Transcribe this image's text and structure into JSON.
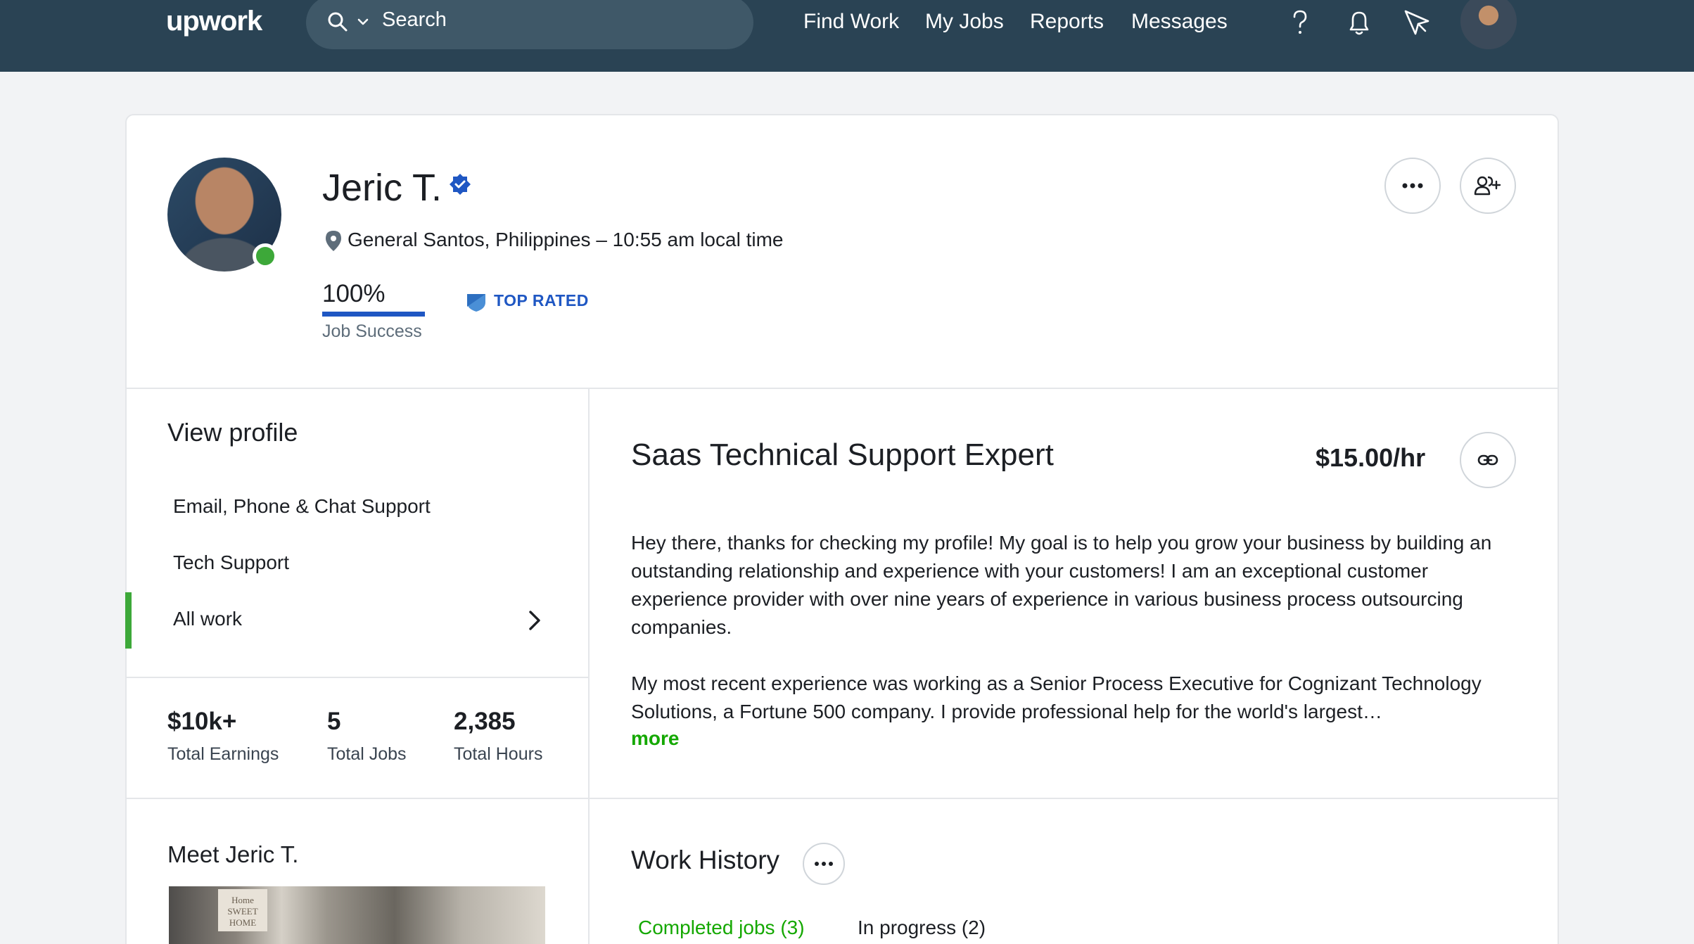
{
  "nav": {
    "logo": "upwork",
    "search_label": "Search",
    "links": [
      "Find Work",
      "My Jobs",
      "Reports",
      "Messages"
    ],
    "icons": [
      "search-icon",
      "chevron-down-icon",
      "help-icon",
      "bell-icon",
      "direct-contracts-icon"
    ],
    "colors": {
      "bar": "#2a4354",
      "search": "#3f5868"
    }
  },
  "profile": {
    "name": "Jeric T.",
    "location": "General Santos, Philippines – 10:55 am local time",
    "job_success": {
      "value": "100%",
      "label": "Job Success",
      "fraction": 1.0
    },
    "badge": "TOP RATED",
    "online": true,
    "colors": {
      "accent_blue": "#1f57c3",
      "online_green": "#3da839"
    }
  },
  "sidebar": {
    "title": "View profile",
    "items": [
      {
        "label": "Email, Phone & Chat Support",
        "active": false
      },
      {
        "label": "Tech Support",
        "active": false
      },
      {
        "label": "All work",
        "active": true
      }
    ]
  },
  "stats": [
    {
      "value": "$10k+",
      "label": "Total Earnings"
    },
    {
      "value": "5",
      "label": "Total Jobs"
    },
    {
      "value": "2,385",
      "label": "Total Hours"
    }
  ],
  "video": {
    "title": "Meet Jeric T.",
    "sign_text": [
      "Home",
      "SWEET",
      "HOME"
    ]
  },
  "job": {
    "title": "Saas Technical Support Expert",
    "rate": "$15.00/hr",
    "overview": [
      "Hey there, thanks for checking my profile! My goal is to help you grow your business by building an outstanding relationship and experience with your customers! I am an exceptional customer experience provider with over nine years of experience in various business process outsourcing companies.",
      "My most recent experience was working as a Senior Process Executive for Cognizant Technology Solutions, a Fortune 500 company. I provide professional help for the world's largest…"
    ],
    "more_label": "more"
  },
  "work_history": {
    "title": "Work History",
    "tabs": [
      {
        "label": "Completed jobs (3)",
        "active": true,
        "color": "#14a800"
      },
      {
        "label": "In progress (2)",
        "active": false,
        "color": "#1c1f24"
      }
    ]
  }
}
